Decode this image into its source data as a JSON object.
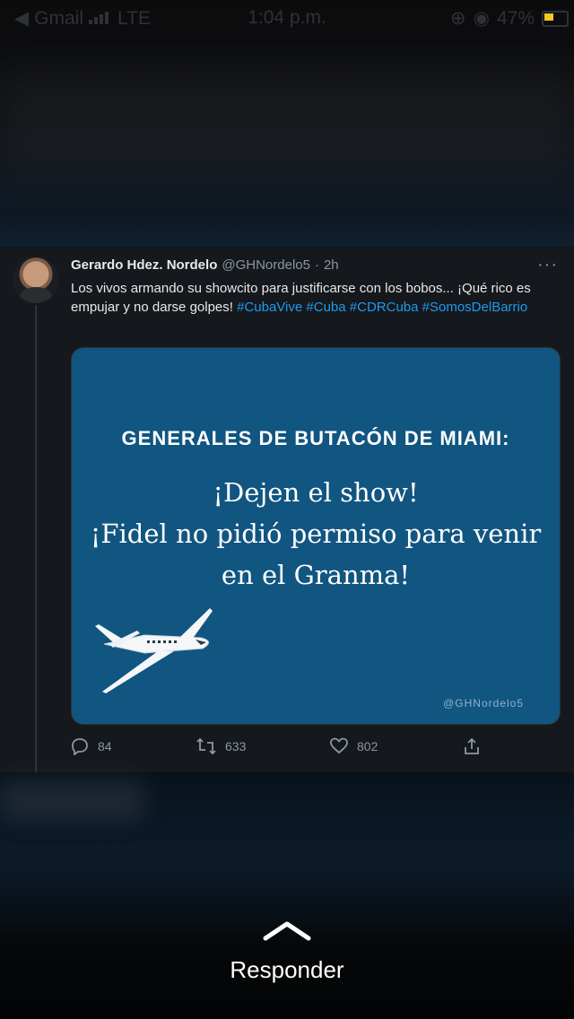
{
  "status_bar": {
    "back_app": "Gmail",
    "network": "LTE",
    "time": "1:04 p.m.",
    "battery": "47%",
    "battery_color": "#f3c623"
  },
  "tweet": {
    "author_name": "Gerardo Hdez. Nordelo",
    "author_handle": "@GHNordelo5",
    "separator": "·",
    "time_ago": "2h",
    "more_label": "···",
    "text_plain": "Los vivos armando su showcito para justificarse con los bobos... ¡Qué rico es empujar y no darse golpes!",
    "hashtags": [
      "#CubaVive",
      "#Cuba",
      "#CDRCuba",
      "#SomosDelBarrio"
    ],
    "hashtag_color": "#1d9bf0",
    "media": {
      "background": "#115581",
      "heading": "GENERALES DE BUTACÓN DE MIAMI:",
      "line1": "¡Dejen el show!",
      "line2": "¡Fidel no pidió permiso para venir",
      "line3": "en el Granma!",
      "watermark": "@GHNordelo5",
      "illustration": "airplane-icon"
    },
    "actions": {
      "replies": "84",
      "retweets": "633",
      "likes": "802"
    }
  },
  "footer": {
    "swipe_icon": "chevron-up-icon",
    "responder_label": "Responder"
  }
}
